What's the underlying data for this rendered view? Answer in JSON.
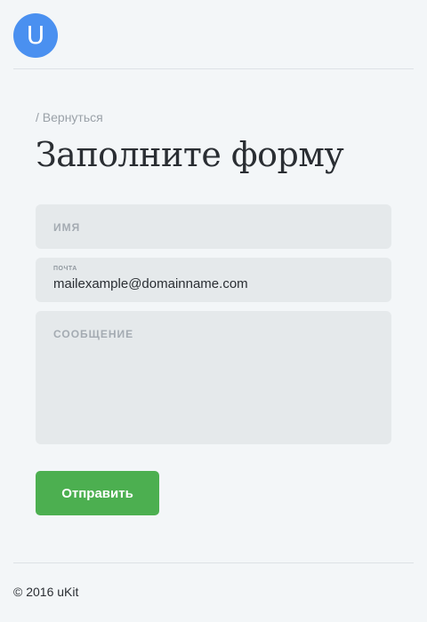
{
  "header": {
    "logo_letter": "U"
  },
  "nav": {
    "back_link": "/ Вернуться"
  },
  "page": {
    "title": "Заполните форму"
  },
  "form": {
    "name": {
      "placeholder": "ИМЯ",
      "value": ""
    },
    "email": {
      "label": "ПОЧТА",
      "value": "mailexample@domainname.com"
    },
    "message": {
      "placeholder": "СООБЩЕНИЕ",
      "value": ""
    },
    "submit_label": "Отправить"
  },
  "footer": {
    "copyright": "© 2016 uKit"
  },
  "colors": {
    "accent": "#4a90f0",
    "submit_button": "#4caf50",
    "field_background": "#e5e9eb",
    "page_background": "#f3f6f8"
  }
}
